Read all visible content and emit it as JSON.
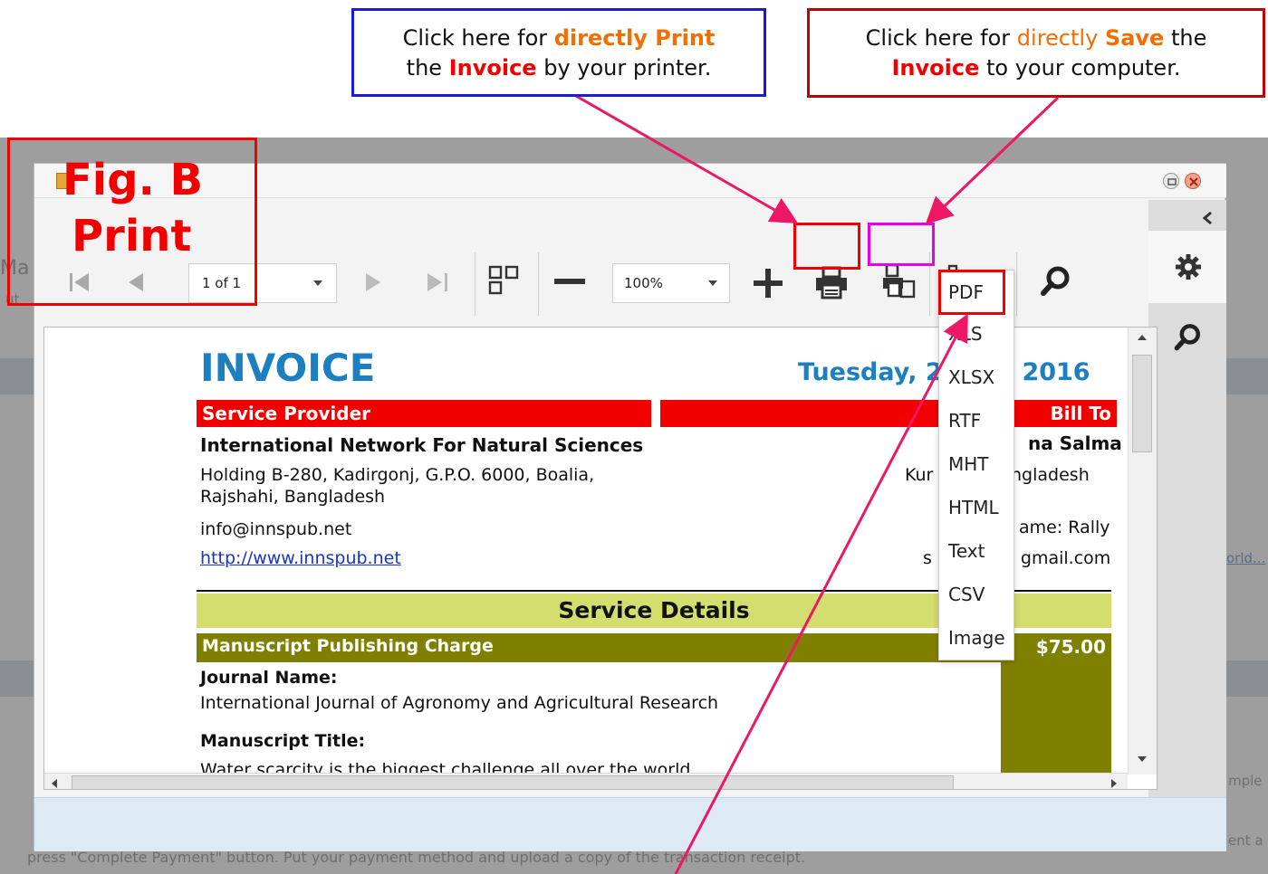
{
  "annotations": {
    "print_callout": {
      "line1_a": "Click here for ",
      "line1_b": "directly Print",
      "line2_a": "the ",
      "line2_b": "Invoice",
      "line2_c": " by your printer."
    },
    "save_callout": {
      "line1_a": "Click here for ",
      "line1_b": "directly",
      "line1_c": " ",
      "line1_d": "Save",
      "line1_e": " the",
      "line2_a": "Invoice",
      "line2_b": " to your computer."
    },
    "figure_label_1": "Fig. B",
    "figure_label_2": "Print"
  },
  "background_page": {
    "left_fragment_1": "Ma",
    "left_fragment_2": "ut",
    "right_fragment_1": "orld...",
    "right_fragment_2": "mple",
    "right_fragment_3": "ent a",
    "bottom_text": "press \"Complete Payment\" button. Put your payment method and upload a copy of the transaction receipt."
  },
  "toolbar": {
    "page_value": "1 of 1",
    "zoom_value": "100%"
  },
  "export_menu": {
    "items": [
      "PDF",
      "XLS",
      "XLSX",
      "RTF",
      "MHT",
      "HTML",
      "Text",
      "CSV",
      "Image"
    ]
  },
  "invoice": {
    "title": "INVOICE",
    "date": "Tuesday, 2",
    "date_tail": "e 2016",
    "service_provider_label": "Service Provider",
    "bill_to_label": "Bill To",
    "provider_name": "International Network For Natural Sciences",
    "provider_address_1": "Holding B-280, Kadirgonj, G.P.O. 6000, Boalia,",
    "provider_address_2": "Rajshahi, Bangladesh",
    "provider_email": "info@innspub.net",
    "provider_url": "http://www.innspub.net",
    "bill_name_fragment": "na Salma",
    "bill_addr_fragment_a": "Kur",
    "bill_addr_fragment_b": "angladesh",
    "bill_name_label_fragment": "ame: Rally",
    "bill_email_fragment_a": "s",
    "bill_email_fragment_b": "gmail.com",
    "service_details_label": "Service Details",
    "charge_label": "Manuscript Publishing Charge",
    "charge_amount": "$75.00",
    "journal_name_label": "Journal Name:",
    "journal_name": "International Journal of Agronomy and Agricultural Research",
    "manuscript_title_label": "Manuscript Title:",
    "manuscript_title": "Water scarcity is the biggest challenge all over the world"
  },
  "colors": {
    "accent_blue": "#1c7fbf",
    "header_red": "#f20000",
    "olive": "#808000",
    "light_olive": "#d4de6e",
    "annotation_orange": "#f36d00",
    "arrow_pink": "#ec1865"
  }
}
